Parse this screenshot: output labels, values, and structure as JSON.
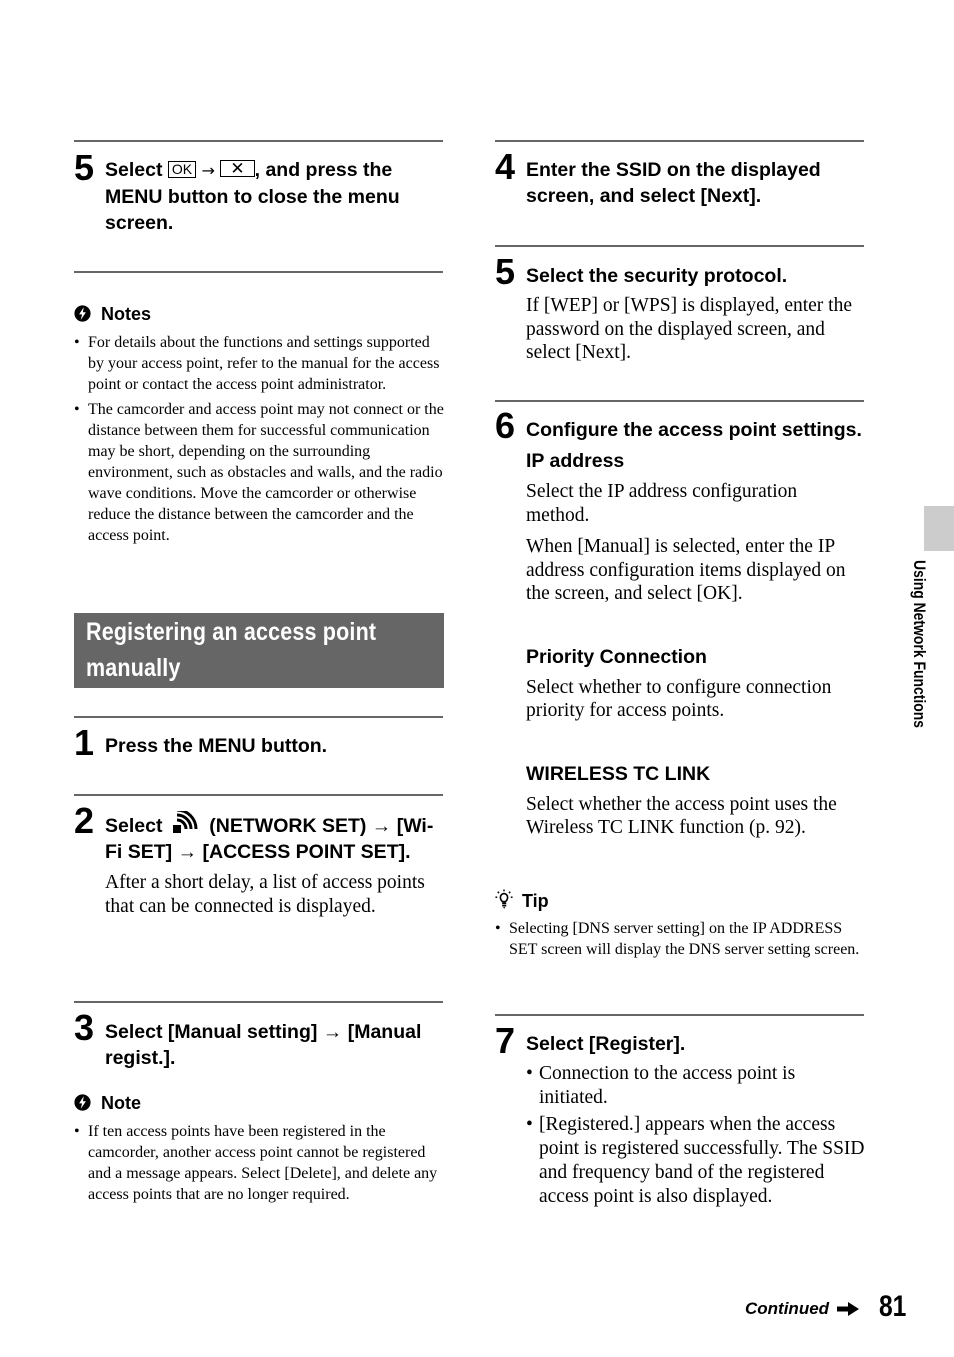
{
  "left_column": {
    "step5": {
      "number": "5",
      "title_prefix": "Select",
      "ok_icon_label": "OK",
      "arrow": "→",
      "close_icon_label": "✕",
      "title_suffix": ", and press the MENU button to close the menu screen."
    },
    "notes": {
      "heading": "Notes",
      "items": [
        "For details about the functions and settings supported by your access point, refer to the manual for the access point or contact the access point administrator.",
        "The camcorder and access point may not connect or the distance between them for successful communication may be short, depending on the surrounding environment, such as obstacles and walls, and the radio wave conditions. Move the camcorder or otherwise reduce the distance between the camcorder and the access point."
      ]
    },
    "section_heading": {
      "line1": "Registering an access point",
      "line2": "manually"
    },
    "step1": {
      "number": "1",
      "title": "Press the MENU button."
    },
    "step2": {
      "number": "2",
      "title_prefix": "Select",
      "title_suffix": "(NETWORK SET) → [Wi-Fi SET] → [ACCESS POINT SET].",
      "body": "After a short delay, a list of access points that can be connected is displayed."
    },
    "step3": {
      "number": "3",
      "title": "Select [Manual setting] → [Manual regist.]."
    },
    "note": {
      "heading": "Note",
      "items": [
        "If ten access points have been registered in the camcorder, another access point cannot be registered and a message appears. Select [Delete], and delete any access points that are no longer required."
      ]
    }
  },
  "right_column": {
    "step4": {
      "number": "4",
      "title": "Enter the SSID on the displayed screen, and select [Next]."
    },
    "step5": {
      "number": "5",
      "title": "Select the security protocol.",
      "body": "If [WEP] or [WPS] is displayed, enter the password on the displayed screen, and select [Next]."
    },
    "step6": {
      "number": "6",
      "title": "Configure the access point settings.",
      "subsections": [
        {
          "heading": "IP address",
          "paragraphs": [
            "Select the IP address configuration method.",
            "When [Manual] is selected, enter the IP address configuration items displayed on the screen, and select [OK]."
          ]
        },
        {
          "heading": "Priority Connection",
          "paragraphs": [
            "Select whether to configure connection priority for access points."
          ]
        },
        {
          "heading": "WIRELESS TC LINK",
          "paragraphs": [
            "Select whether the access point uses the Wireless TC LINK function (p. 92)."
          ]
        }
      ]
    },
    "tip": {
      "heading": "Tip",
      "items": [
        "Selecting [DNS server setting] on the IP ADDRESS SET screen will display the DNS server setting screen."
      ]
    },
    "step7": {
      "number": "7",
      "title": "Select [Register].",
      "items": [
        "Connection to the access point is initiated.",
        "[Registered.] appears when the access point is registered successfully. The SSID and frequency band of the registered access point is also displayed."
      ]
    }
  },
  "side_tab": {
    "label": "Using Network Functions"
  },
  "footer": {
    "continued": "Continued",
    "page_number": "81"
  },
  "colors": {
    "rule": "#666666",
    "section_band": "#666666",
    "side_tab": "#cccccc"
  }
}
